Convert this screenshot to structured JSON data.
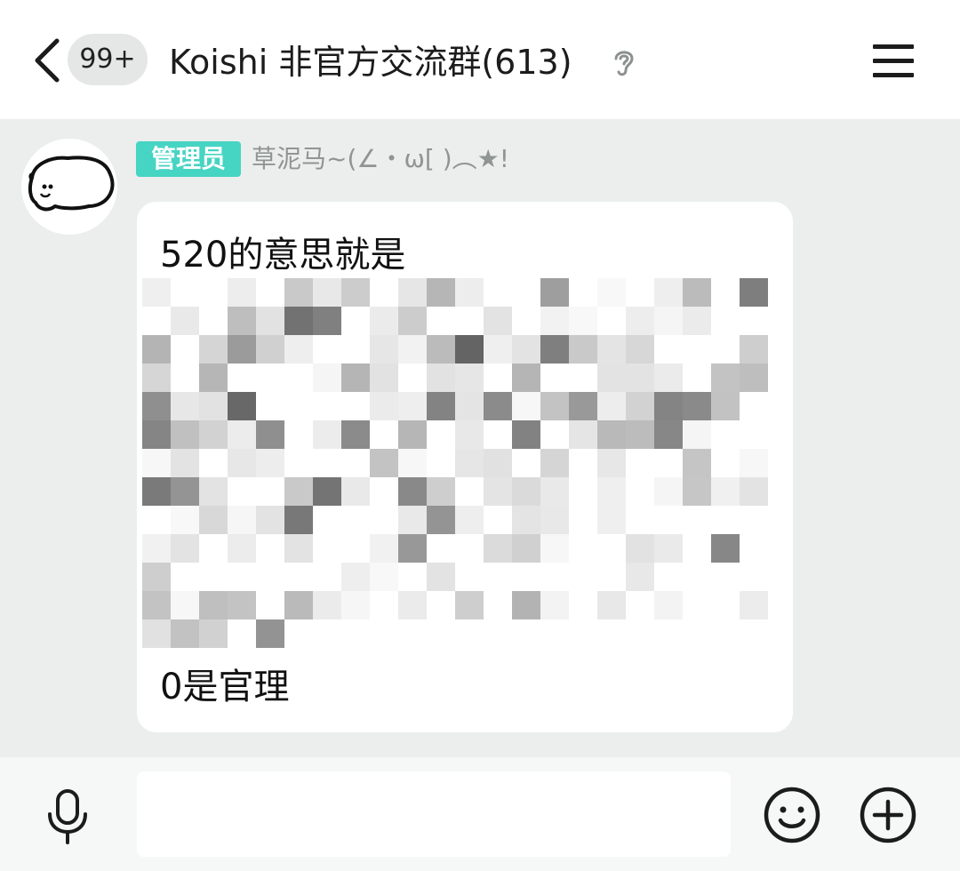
{
  "header": {
    "unread_badge": "99+",
    "title": "Koishi 非官方交流群(613)",
    "icons": {
      "back": "chevron-left-icon",
      "ear": "ear-icon",
      "menu": "menu-icon"
    }
  },
  "message": {
    "role_tag": "管理员",
    "nickname": "草泥马~(∠・ω[ )︵★!",
    "lines": [
      "520的意思就是",
      "0是官理"
    ],
    "redacted": true,
    "tag_color": "#46d4c3"
  },
  "input_bar": {
    "placeholder": "",
    "icons": {
      "mic": "microphone-icon",
      "emoji": "emoji-icon",
      "plus": "plus-icon"
    }
  }
}
